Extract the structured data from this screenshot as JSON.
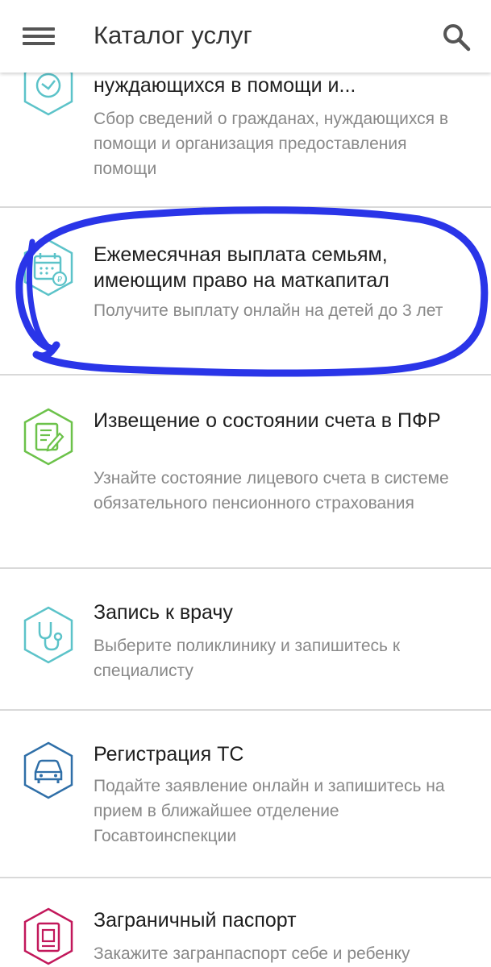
{
  "app_bar": {
    "title": "Каталог услуг",
    "menu_icon": "hamburger-menu-icon",
    "search_icon": "search-icon"
  },
  "services": [
    {
      "title": "нуждающихся в помощи и...",
      "description": "Сбор сведений о гражданах, нуждающихся в помощи и организация предоставления помощи",
      "icon": "help-hands-icon",
      "color": "#5cc3c9"
    },
    {
      "title": "Ежемесячная выплата семьям, имеющим право на маткапитал",
      "description": "Получите выплату онлайн на детей до 3 лет",
      "icon": "calendar-ruble-icon",
      "color": "#5cc3c9"
    },
    {
      "title": "Извещение о состоянии счета в ПФР",
      "description": "Узнайте состояние лицевого счета в системе обязательного пенсионного страхования",
      "icon": "document-edit-icon",
      "color": "#6cc24a"
    },
    {
      "title": "Запись к врачу",
      "description": "Выберите поликлинику и запишитесь к специалисту",
      "icon": "stethoscope-icon",
      "color": "#5cc3c9"
    },
    {
      "title": "Регистрация ТС",
      "description": "Подайте заявление онлайн и запишитесь на прием в ближайшее отделение Госавтоинспекции",
      "icon": "car-icon",
      "color": "#2f6fa8"
    },
    {
      "title": "Заграничный паспорт",
      "description": "Закажите загранпаспорт себе и ребенку",
      "icon": "passport-icon",
      "color": "#c2185b"
    }
  ],
  "annotation": {
    "color": "#2a35e8"
  }
}
